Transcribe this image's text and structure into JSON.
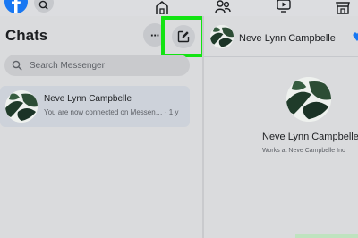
{
  "left_panel": {
    "title": "Chats",
    "more_label": "···",
    "search": {
      "placeholder": "Search Messenger"
    },
    "chats": [
      {
        "name": "Neve Lynn Campbelle",
        "preview": "You are now connected on Messen… · 1 y"
      }
    ]
  },
  "conversation": {
    "contact_name": "Neve Lynn Campbelle",
    "profile_name": "Neve Lynn Campbelle",
    "profile_work": "Works at Neve Campbelle Inc"
  },
  "colors": {
    "highlight": "#12e312",
    "facebook_blue": "#1877f2",
    "background": "#dadbdd",
    "selected_chat": "#cdd2da"
  },
  "icons": {
    "logo": "facebook-logo-icon",
    "top_search": "search-icon",
    "nav": [
      "home-icon",
      "people-icon",
      "watch-icon",
      "marketplace-icon"
    ],
    "compose": "compose-icon",
    "header_action": "heart-icon"
  }
}
